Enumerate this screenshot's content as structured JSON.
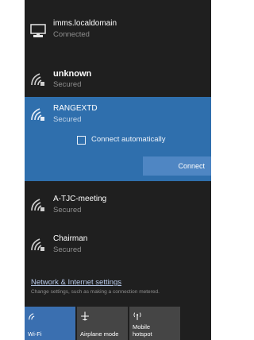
{
  "networks": [
    {
      "name": "imms.localdomain",
      "status": "Connected",
      "icon": "ethernet-icon"
    },
    {
      "name": "unknown",
      "status": "Secured",
      "icon": "wifi-icon"
    },
    {
      "name": "RANGEXTD",
      "status": "Secured",
      "icon": "wifi-icon"
    },
    {
      "name": "A-TJC-meeting",
      "status": "Secured",
      "icon": "wifi-icon"
    },
    {
      "name": "Chairman",
      "status": "Secured",
      "icon": "wifi-icon"
    }
  ],
  "expanded": {
    "connect_auto_label": "Connect automatically",
    "connect_button_label": "Connect"
  },
  "footer": {
    "settings_link": "Network & Internet settings",
    "settings_hint": "Change settings, such as making a connection metered."
  },
  "quick_actions": [
    {
      "label": "Wi-Fi",
      "icon": "wifi-icon",
      "active": true
    },
    {
      "label": "Airplane mode",
      "icon": "airplane-icon",
      "active": false
    },
    {
      "label": "Mobile hotspot",
      "label_line1": "Mobile",
      "label_line2": "hotspot",
      "icon": "hotspot-icon",
      "active": false
    }
  ],
  "colors": {
    "panel_bg": "#1f1f1f",
    "selected_bg": "#2f6fad",
    "accent": "#4f86c3",
    "tile_active": "#3a6fb0",
    "tile_inactive": "#454545"
  }
}
